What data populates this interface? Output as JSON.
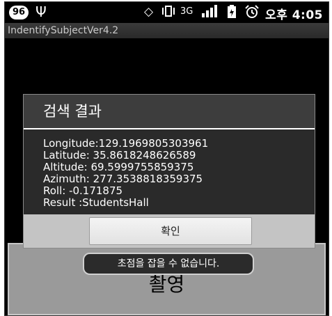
{
  "status_bar": {
    "notification_count": "96",
    "usb_icon": "usb-icon",
    "sync_icon": "sync-icon",
    "vibrate_icon": "vibrate-icon",
    "network_type": "3G",
    "signal_icon": "signal-icon",
    "battery_icon": "battery-icon",
    "alarm_icon": "alarm-icon",
    "time": "오후 4:05"
  },
  "app": {
    "title": "IndentifySubjectVer4.2"
  },
  "dialog": {
    "title": "검색 결과",
    "lines": [
      "Longitude:129.1969805303961",
      "Latitude: 35.8618248626589",
      "Altitude: 69.5999755859375",
      "Azimuth: 277.3538818359375",
      "Roll: -0.171875",
      "Result :StudentsHall"
    ],
    "ok_label": "확인"
  },
  "shoot_button": {
    "label": "촬영"
  },
  "toast": {
    "message": "초점을 잡을 수 없습니다."
  }
}
